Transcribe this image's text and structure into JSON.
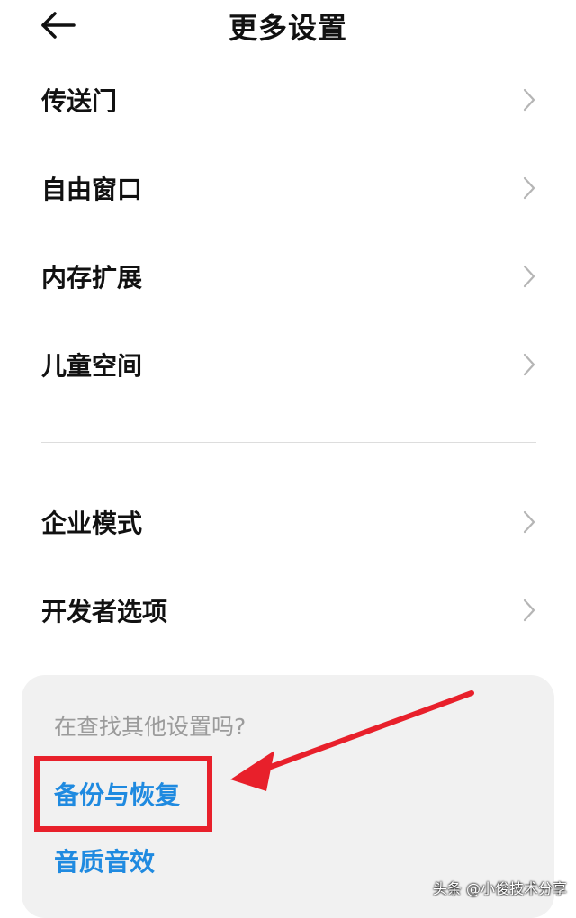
{
  "header": {
    "title": "更多设置",
    "back_icon": "arrow-left-icon"
  },
  "menu": {
    "group1": [
      {
        "label": "传送门"
      },
      {
        "label": "自由窗口"
      },
      {
        "label": "内存扩展"
      },
      {
        "label": "儿童空间"
      }
    ],
    "group2": [
      {
        "label": "企业模式"
      },
      {
        "label": "开发者选项"
      }
    ]
  },
  "suggestions": {
    "hint": "在查找其他设置吗?",
    "links": [
      {
        "label": "备份与恢复"
      },
      {
        "label": "音质音效"
      }
    ]
  },
  "annotation": {
    "highlight_color": "#e8202b"
  },
  "watermark": {
    "text": "头条 @小俊技术分享"
  },
  "colors": {
    "link": "#1f8ae0",
    "text": "#111111",
    "hint": "#9b9b9b",
    "card_bg": "#f1f1f1"
  }
}
